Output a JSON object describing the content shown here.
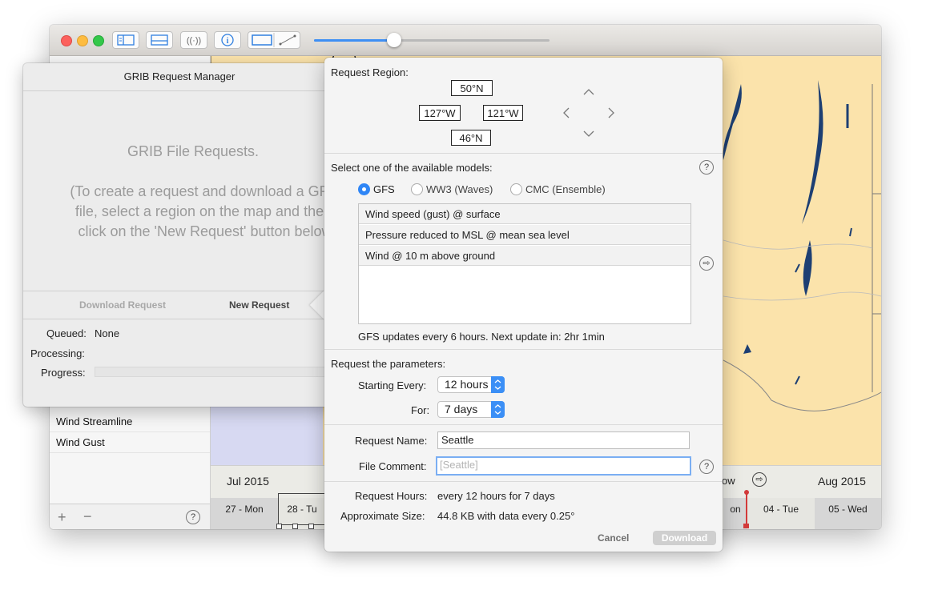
{
  "main_window": {
    "toolbar": {
      "zoom_level": 0.34,
      "icons": [
        "sidebar-icon",
        "bottom-panel-icon",
        "broadcast-icon",
        "info-icon",
        "region-select-icon",
        "measure-line-icon"
      ],
      "colors": {
        "accent": "#3e8ff4",
        "close": "#fc615d",
        "minimize": "#fdbc40",
        "zoom": "#34c84a"
      }
    },
    "sidebar": {
      "items": [
        {
          "label": "Wind Streamline"
        },
        {
          "label": "Wind Gust"
        }
      ],
      "add_label": "+",
      "remove_label": "−",
      "help_label": "?"
    },
    "timeline": {
      "month_left": "Jul 2015",
      "month_right": "Aug 2015",
      "now_label": "ow",
      "days_left": [
        "27 - Mon",
        "28 - Tu"
      ],
      "day_mid": "on",
      "days_right": [
        "04 - Tue",
        "05 - Wed"
      ]
    },
    "map_colors": {
      "land": "#fbe3ab",
      "water": "#1d3f73"
    }
  },
  "grib_manager": {
    "title": "GRIB Request Manager",
    "empty_title": "GRIB File Requests.",
    "empty_lines": [
      "(To create a request and download a GRIB",
      "file, select a region on the map and then",
      "click on the 'New Request' button below."
    ],
    "download_request_label": "Download Request",
    "new_request_label": "New Request",
    "queued_label": "Queued:",
    "queued_value": "None",
    "processing_label": "Processing:",
    "progress_label": "Progress:",
    "progress_value": 0
  },
  "request_popover": {
    "region_label": "Request Region:",
    "north": "50°N",
    "west": "127°W",
    "east": "121°W",
    "south": "46°N",
    "models_label": "Select one of the available models:",
    "models": [
      {
        "label": "GFS",
        "selected": true
      },
      {
        "label": "WW3 (Waves)",
        "selected": false
      },
      {
        "label": "CMC (Ensemble)",
        "selected": false
      }
    ],
    "parameters": [
      "Wind speed (gust) @ surface",
      "Pressure reduced to MSL @ mean sea level",
      "Wind @ 10 m above ground"
    ],
    "update_info": "GFS updates every 6 hours.  Next update in: 2hr 1min",
    "params_label": "Request the parameters:",
    "starting_every_label": "Starting Every:",
    "starting_every_value": "12 hours",
    "for_label": "For:",
    "for_value": "7 days",
    "request_name_label": "Request Name:",
    "request_name_value": "Seattle",
    "file_comment_label": "File Comment:",
    "file_comment_placeholder": "[Seattle]",
    "request_hours_label": "Request Hours:",
    "request_hours_value": "every 12 hours for 7 days",
    "approx_size_label": "Approximate Size:",
    "approx_size_value": "44.8 KB with data every 0.25°",
    "cancel_label": "Cancel",
    "download_label": "Download",
    "help_label": "?"
  }
}
